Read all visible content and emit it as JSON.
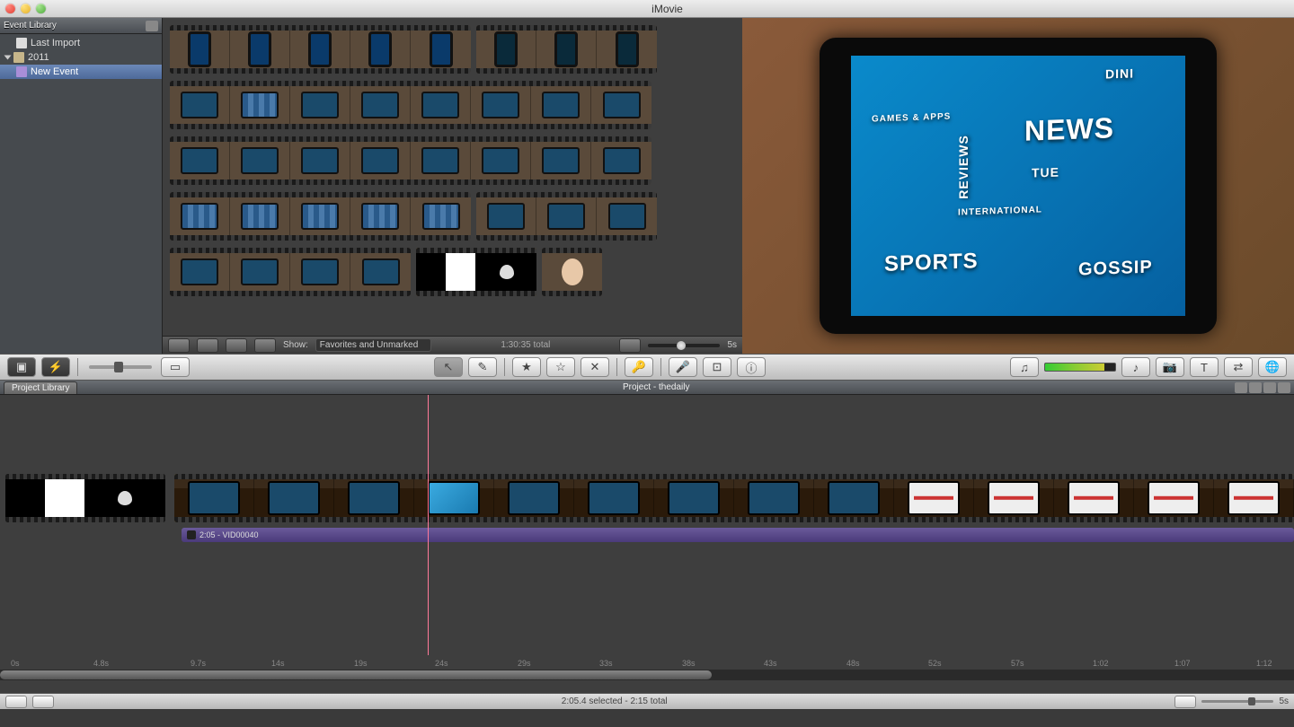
{
  "app": {
    "title": "iMovie"
  },
  "sidebar": {
    "header": "Event Library",
    "items": [
      {
        "label": "Last Import"
      },
      {
        "label": "2011"
      },
      {
        "label": "New Event"
      }
    ]
  },
  "eventToolbar": {
    "showLabel": "Show:",
    "showValue": "Favorites and Unmarked",
    "total": "1:30:35 total",
    "zoomValue": "5s"
  },
  "viewer": {
    "tiles": [
      "NEWS",
      "SPORTS",
      "GOSSIP",
      "REVIEWS",
      "GAMES & APPS",
      "INTERNATIONAL",
      "DINI",
      "TUE"
    ]
  },
  "projectHeader": {
    "tab": "Project Library",
    "title": "Project - thedaily"
  },
  "timeline": {
    "audioClip": "2:05 - VID00040",
    "ruler": [
      "0s",
      "4.8s",
      "9.7s",
      "14s",
      "19s",
      "24s",
      "29s",
      "33s",
      "38s",
      "43s",
      "48s",
      "52s",
      "57s",
      "1:02",
      "1:07",
      "1:12"
    ]
  },
  "bottombar": {
    "status": "2:05.4 selected - 2:15 total",
    "zoomValue": "5s"
  }
}
